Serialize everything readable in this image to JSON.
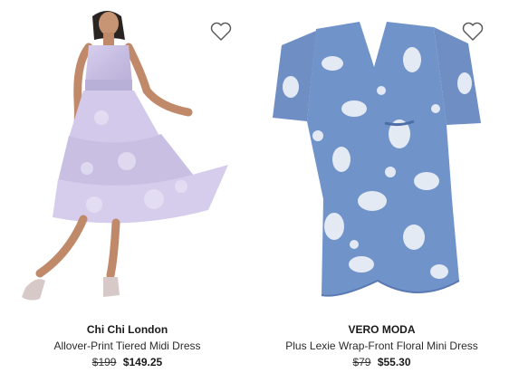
{
  "products": [
    {
      "brand": "Chi Chi London",
      "title": "Allover-Print Tiered Midi Dress",
      "original_price": "$199",
      "sale_price": "$149.25",
      "favorite_icon": "heart-outline-icon"
    },
    {
      "brand": "VERO MODA",
      "title": "Plus Lexie Wrap-Front Floral Mini Dress",
      "original_price": "$79",
      "sale_price": "$55.30",
      "favorite_icon": "heart-outline-icon"
    }
  ],
  "colors": {
    "text": "#1a1a1a",
    "background": "#ffffff",
    "dress1": "#c9bfe0",
    "dress2": "#6f8fc4"
  }
}
